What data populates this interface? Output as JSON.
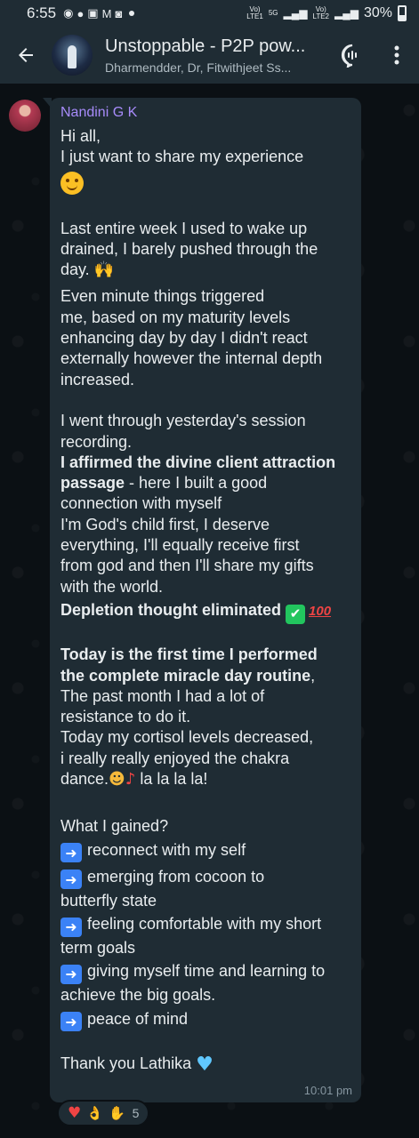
{
  "status_bar": {
    "time": "6:55",
    "network_label": "5G",
    "battery": "30%"
  },
  "header": {
    "title": "Unstoppable - P2P pow...",
    "subtitle": "Dharmendder, Dr, Fitwithjeet Ss..."
  },
  "message": {
    "sender": "Nandini G K",
    "time": "10:01 pm",
    "lines": {
      "l1": "Hi all,",
      "l2": "I just want to share my experience",
      "l4": "Last entire week I used to wake up",
      "l5": "drained, I barely pushed through the",
      "l6": "day.",
      "l7": "Even minute things triggered",
      "l8": "me, based on my maturity levels",
      "l9": "enhancing day by day I didn't react",
      "l10": "externally however the internal depth",
      "l11": "increased.",
      "l12": "I went through yesterday's session",
      "l13": "recording.",
      "l14": "I affirmed the divine client attraction",
      "l15_bold": "passage",
      "l15_rest": " - here I built a good",
      "l16": "connection with myself",
      "l17": "I'm God's child first, I deserve",
      "l18": "everything, I'll equally receive first",
      "l19": "from god and then I'll share my gifts",
      "l20": "with the world.",
      "l21": "Depletion thought eliminated",
      "l21_badge": "100",
      "l22": "Today is the first time I performed",
      "l23_bold": "the complete miracle day routine",
      "l23_rest": ",",
      "l24": "The past month I had a lot of",
      "l25": "resistance to do it.",
      "l26": "Today my cortisol levels decreased,",
      "l27": "i really really enjoyed the chakra",
      "l28a": "dance.",
      "l28b": " la la la la!",
      "l29": "What I gained?",
      "l30": "reconnect with my self",
      "l31": "emerging from cocoon to",
      "l32": "butterfly state",
      "l33": "feeling comfortable with my short",
      "l34": "term goals",
      "l35": "giving myself time and learning to",
      "l36": "achieve the big goals.",
      "l37": "peace of mind",
      "l38": "Thank you Lathika"
    }
  },
  "reactions": {
    "count": "5"
  },
  "colors": {
    "bubble": "#1f2c34",
    "background": "#0b1014",
    "sender_name": "#a78bfa",
    "timestamp": "#8696a0"
  }
}
